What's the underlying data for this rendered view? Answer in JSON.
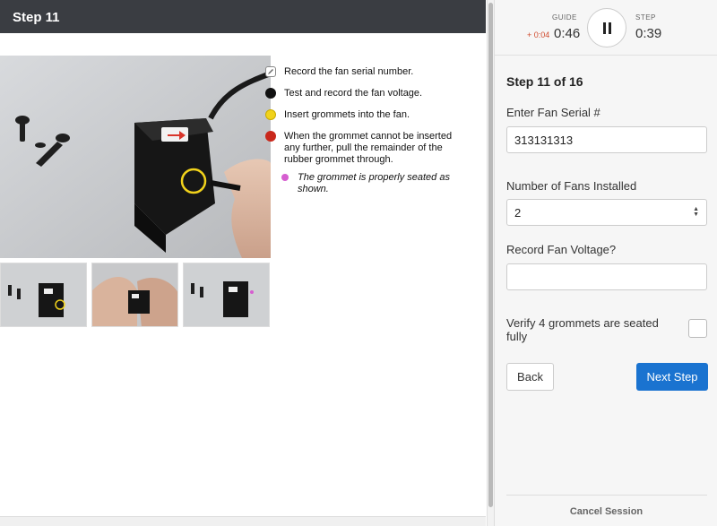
{
  "header": {
    "title": "Step 11"
  },
  "guide": {
    "instructions": [
      {
        "text": "Record the fan serial number.",
        "bullet": "data-entry-icon"
      },
      {
        "text": "Test and record the fan voltage.",
        "bullet": "black",
        "color": "#111111"
      },
      {
        "text": "Insert grommets into the fan.",
        "bullet": "yellow",
        "color": "#f1d21b"
      },
      {
        "text": "When the grommet cannot be inserted any further, pull the remainder of the rubber grommet through.",
        "bullet": "red",
        "color": "#c9281c"
      },
      {
        "text": "The grommet is properly seated as shown.",
        "bullet": "pink",
        "color": "#d65ed0"
      }
    ]
  },
  "timers": {
    "guide_label": "GUIDE",
    "guide_delta": "+ 0:04",
    "guide_time": "0:46",
    "step_label": "STEP",
    "step_time": "0:39"
  },
  "form": {
    "step_count": "Step 11 of 16",
    "serial_label": "Enter Fan Serial #",
    "serial_value": "313131313",
    "fans_label": "Number of Fans Installed",
    "fans_value": "2",
    "voltage_label": "Record Fan Voltage?",
    "voltage_value": "",
    "verify_label": "Verify 4 grommets are seated fully",
    "verify_checked": false,
    "back_label": "Back",
    "next_label": "Next Step",
    "cancel_label": "Cancel Session"
  },
  "colors": {
    "header_bg": "#3a3d42",
    "primary": "#1a73d0",
    "delta_red": "#d04b2e"
  }
}
